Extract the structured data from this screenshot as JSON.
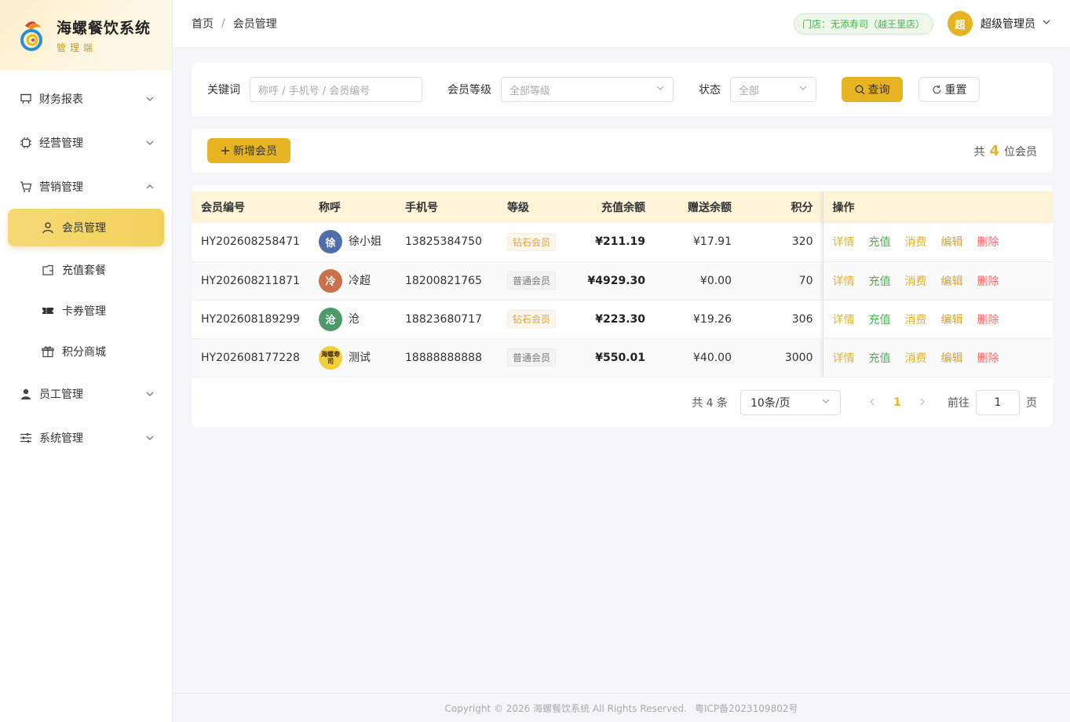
{
  "brand": {
    "title": "海螺餐饮系统",
    "subtitle": "管理端"
  },
  "sidebar": {
    "items": [
      {
        "label": "财务报表",
        "icon": "report-icon"
      },
      {
        "label": "经营管理",
        "icon": "chip-icon"
      },
      {
        "label": "营销管理",
        "icon": "cart-icon"
      },
      {
        "label": "员工管理",
        "icon": "user-icon"
      },
      {
        "label": "系统管理",
        "icon": "sliders-icon"
      }
    ],
    "sub_items": [
      {
        "label": "会员管理",
        "icon": "user-outline-icon"
      },
      {
        "label": "充值套餐",
        "icon": "wallet-icon"
      },
      {
        "label": "卡券管理",
        "icon": "ticket-icon"
      },
      {
        "label": "积分商城",
        "icon": "gift-icon"
      }
    ]
  },
  "header": {
    "breadcrumb": [
      "首页",
      "/",
      "会员管理"
    ],
    "store": "门店：无添寿司（越王里店）",
    "avatar_text": "超",
    "user": "超级管理员"
  },
  "search": {
    "keyword_label": "关键词",
    "keyword_placeholder": "称呼 / 手机号 / 会员编号",
    "level_label": "会员等级",
    "level_value": "全部等级",
    "status_label": "状态",
    "status_value": "全部",
    "query_label": "查询",
    "reset_label": "重置"
  },
  "toolbar": {
    "add_label": "新增会员",
    "count_prefix": "共",
    "count": "4",
    "count_suffix": "位会员"
  },
  "table": {
    "columns": [
      "会员编号",
      "称呼",
      "手机号",
      "等级",
      "充值余额",
      "赠送余额",
      "积分",
      "操作"
    ],
    "ops": [
      "详情",
      "充值",
      "消费",
      "编辑",
      "删除"
    ],
    "rows": [
      {
        "id": "HY202608258471",
        "avatar": "徐",
        "name": "徐小姐",
        "phone": "13825384750",
        "level": "钻石会员",
        "recharge": "¥211.19",
        "gift": "¥17.91",
        "points": "320"
      },
      {
        "id": "HY202608211871",
        "avatar": "冷",
        "name": "冷超",
        "phone": "18200821765",
        "level": "普通会员",
        "recharge": "¥4929.30",
        "gift": "¥0.00",
        "points": "70"
      },
      {
        "id": "HY202608189299",
        "avatar": "沧",
        "name": "沧",
        "phone": "18823680717",
        "level": "钻石会员",
        "recharge": "¥223.30",
        "gift": "¥19.26",
        "points": "306"
      },
      {
        "id": "HY202608177228",
        "avatar": "海螺寿司",
        "name": "测试",
        "phone": "18888888888",
        "level": "普通会员",
        "recharge": "¥550.01",
        "gift": "¥40.00",
        "points": "3000"
      }
    ]
  },
  "pager": {
    "total": "共 4 条",
    "page_size": "10条/页",
    "current": "1",
    "goto_label": "前往",
    "goto_value": "1",
    "page_unit": "页"
  },
  "footer": {
    "copyright": "Copyright © 2026 海螺餐饮系统 All Rights Reserved.",
    "icp": "粤ICP备2023109802号"
  },
  "colors": {
    "accent": "#e6b422",
    "success": "#4caf50",
    "danger": "#f56c6c",
    "warning": "#e6a23c"
  }
}
